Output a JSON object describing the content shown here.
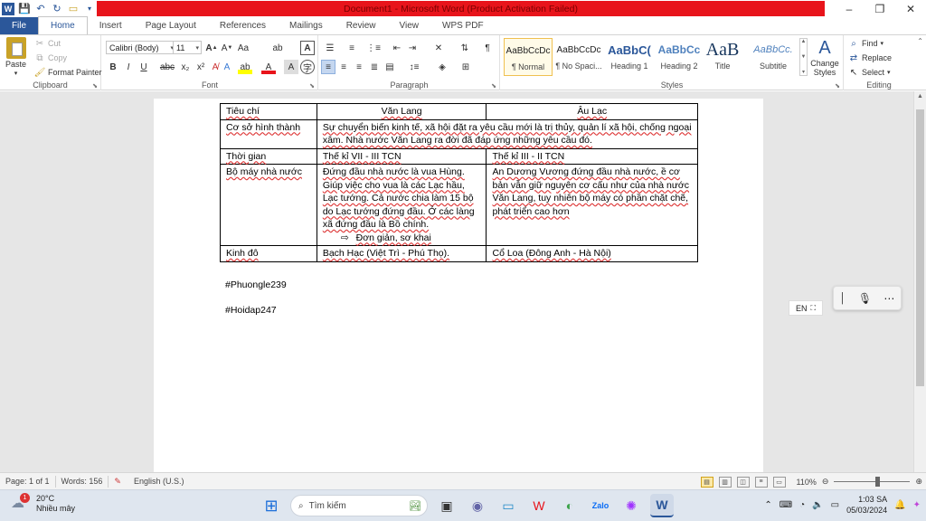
{
  "titlebar": {
    "title": "Document1 - Microsoft Word (Product Activation Failed)",
    "controls": [
      "–",
      "❐",
      "✕"
    ]
  },
  "tabs": [
    {
      "label": "File"
    },
    {
      "label": "Home"
    },
    {
      "label": "Insert"
    },
    {
      "label": "Page Layout"
    },
    {
      "label": "References"
    },
    {
      "label": "Mailings"
    },
    {
      "label": "Review"
    },
    {
      "label": "View"
    },
    {
      "label": "WPS PDF"
    }
  ],
  "ribbon": {
    "clipboard": {
      "label": "Clipboard",
      "paste": "Paste",
      "cut": "Cut",
      "copy": "Copy",
      "format_painter": "Format Painter"
    },
    "font": {
      "label": "Font",
      "family": "Calibri (Body)",
      "size": "11"
    },
    "paragraph": {
      "label": "Paragraph"
    },
    "styles": {
      "label": "Styles",
      "items": [
        {
          "sample": "AaBbCcDc",
          "name": "¶ Normal"
        },
        {
          "sample": "AaBbCcDc",
          "name": "¶ No Spaci..."
        },
        {
          "sample": "AaBbC(",
          "name": "Heading 1"
        },
        {
          "sample": "AaBbCc",
          "name": "Heading 2"
        },
        {
          "sample": "AaB",
          "name": "Title"
        },
        {
          "sample": "AaBbCc.",
          "name": "Subtitle"
        }
      ],
      "change_styles": "Change Styles"
    },
    "editing": {
      "label": "Editing",
      "find": "Find",
      "replace": "Replace",
      "select": "Select"
    }
  },
  "document": {
    "table": {
      "header": [
        "Tiêu chí",
        "Văn Lang",
        "Âu Lạc"
      ],
      "row_origin": {
        "label": "Cơ sở hình thành",
        "content": "Sự chuyển biến kinh tế, xã hội đặt ra yêu cầu mới là trị thủy, quản lí xã hội, chống ngoại xâm. Nhà nước Văn Lang ra đời đã đáp ứng những yêu cầu đó."
      },
      "row_time": {
        "label": "Thời gian",
        "van_lang": "Thế kỉ VII - III TCN",
        "au_lac": "Thế kỉ III - II TCN"
      },
      "row_state": {
        "label": "Bộ máy nhà nước",
        "van_lang": "Đứng đầu nhà nước là vua Hùng. Giúp việc cho vua là các Lạc hầu, Lạc tướng. Cả nước chia làm 15 bộ do Lạc tướng đứng đầu. Ở các làng xã đứng đầu là Bồ chính.",
        "van_lang_note": "Đơn giản, sơ khai",
        "au_lac": "An Dương Vương đứng đầu nhà nước, ề cơ bản vẫn giữ nguyên cơ cấu như của nhà nước Văn Lang, tuy nhiên bộ máy có phần chặt chẽ, phát triển cao hơn"
      },
      "row_capital": {
        "label": "Kinh đô",
        "van_lang": "Bạch Hạc (Việt Trì - Phú Thọ).",
        "au_lac": "Cổ Loa (Đông Anh - Hà Nội)"
      }
    },
    "tag1": "#Phuongle239",
    "tag2": "#Hoidap247"
  },
  "language_pill": "EN",
  "statusbar": {
    "page": "Page: 1 of 1",
    "words": "Words: 156",
    "language": "English (U.S.)",
    "zoom": "110%"
  },
  "taskbar": {
    "weather_temp": "20°C",
    "weather_desc": "Nhiều mây",
    "weather_badge": "1",
    "search_placeholder": "Tìm kiếm",
    "time": "1:03 SA",
    "date": "05/03/2024"
  }
}
